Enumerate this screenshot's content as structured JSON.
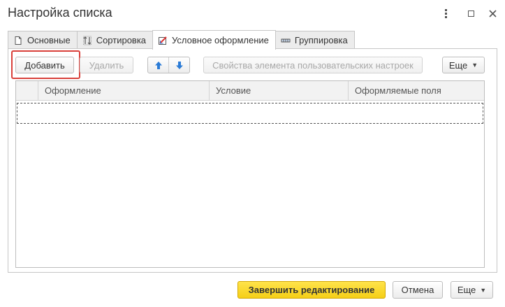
{
  "window": {
    "title": "Настройка списка"
  },
  "tabs": [
    {
      "label": "Основные",
      "icon": "document-icon",
      "active": false
    },
    {
      "label": "Сортировка",
      "icon": "sort-icon",
      "active": false
    },
    {
      "label": "Условное оформление",
      "icon": "conditional-format-icon",
      "active": true
    },
    {
      "label": "Группировка",
      "icon": "grouping-icon",
      "active": false
    }
  ],
  "toolbar": {
    "add_label": "Добавить",
    "delete_label": "Удалить",
    "properties_label": "Свойства элемента пользовательских настроек",
    "more_label": "Еще"
  },
  "table": {
    "columns": [
      "Оформление",
      "Условие",
      "Оформляемые поля"
    ],
    "rows": []
  },
  "footer": {
    "finish_label": "Завершить редактирование",
    "cancel_label": "Отмена",
    "more_label": "Еще"
  },
  "colors": {
    "primary_button": "#f5cf17",
    "highlight_border": "#d9403a",
    "arrow_blue": "#2b7bd6"
  }
}
